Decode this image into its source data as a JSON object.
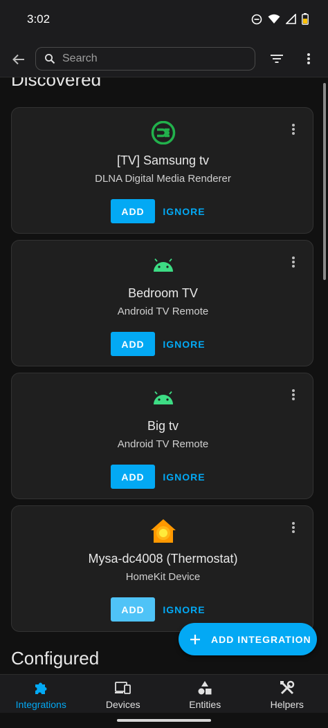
{
  "status_bar": {
    "time": "3:02"
  },
  "header": {
    "search_placeholder": "Search"
  },
  "sections": {
    "discovered": "Discovered",
    "configured": "Configured"
  },
  "cards": [
    {
      "title": "[TV] Samsung tv",
      "subtitle": "DLNA Digital Media Renderer",
      "add_label": "ADD",
      "ignore_label": "IGNORE",
      "icon": "dlna-icon"
    },
    {
      "title": "Bedroom TV",
      "subtitle": "Android TV Remote",
      "add_label": "ADD",
      "ignore_label": "IGNORE",
      "icon": "android-icon"
    },
    {
      "title": "Big tv",
      "subtitle": "Android TV Remote",
      "add_label": "ADD",
      "ignore_label": "IGNORE",
      "icon": "android-icon"
    },
    {
      "title": "Mysa-dc4008 (Thermostat)",
      "subtitle": "HomeKit Device",
      "add_label": "ADD",
      "ignore_label": "IGNORE",
      "icon": "homekit-icon"
    }
  ],
  "fab": {
    "label": "ADD INTEGRATION"
  },
  "bottom_nav": [
    {
      "label": "Integrations",
      "icon": "puzzle-icon",
      "active": true
    },
    {
      "label": "Devices",
      "icon": "devices-icon",
      "active": false
    },
    {
      "label": "Entities",
      "icon": "entities-icon",
      "active": false
    },
    {
      "label": "Helpers",
      "icon": "tools-icon",
      "active": false
    }
  ],
  "colors": {
    "accent": "#03a9f4",
    "android_green": "#3ddc84",
    "dlna_green": "#22b14c",
    "homekit_orange": "#ff9800",
    "background": "#111111",
    "card": "#1f1f1f"
  }
}
